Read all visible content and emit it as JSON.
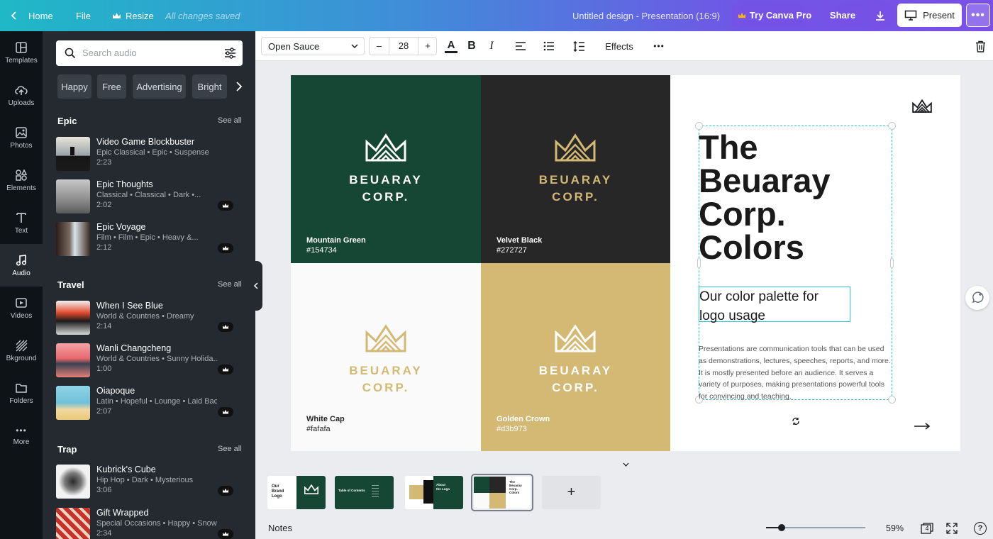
{
  "topbar": {
    "home": "Home",
    "file": "File",
    "resize": "Resize",
    "saved_status": "All changes saved",
    "doc_title": "Untitled design - Presentation (16:9)",
    "try_pro": "Try Canva Pro",
    "share": "Share",
    "present": "Present"
  },
  "rail": [
    {
      "label": "Templates",
      "icon": "templates-icon"
    },
    {
      "label": "Uploads",
      "icon": "upload-cloud-icon"
    },
    {
      "label": "Photos",
      "icon": "image-icon"
    },
    {
      "label": "Elements",
      "icon": "shapes-icon"
    },
    {
      "label": "Text",
      "icon": "text-t-icon"
    },
    {
      "label": "Audio",
      "icon": "music-note-icon"
    },
    {
      "label": "Videos",
      "icon": "video-play-icon"
    },
    {
      "label": "Bkground",
      "icon": "pattern-icon"
    },
    {
      "label": "Folders",
      "icon": "folder-icon"
    },
    {
      "label": "More",
      "icon": "more-dots-icon"
    }
  ],
  "audio_panel": {
    "search_placeholder": "Search audio",
    "chips": [
      "Happy",
      "Free",
      "Advertising",
      "Bright"
    ],
    "see_all": "See all",
    "sections": [
      {
        "title": "Epic",
        "tracks": [
          {
            "title": "Video Game Blockbuster",
            "meta": "Epic Classical • Epic • Suspense",
            "duration": "2:23",
            "pro": false
          },
          {
            "title": "Epic Thoughts",
            "meta": "Classical • Classical • Dark •...",
            "duration": "2:02",
            "pro": true
          },
          {
            "title": "Epic Voyage",
            "meta": "Film • Film • Epic • Heavy &...",
            "duration": "2:12",
            "pro": true
          }
        ]
      },
      {
        "title": "Travel",
        "tracks": [
          {
            "title": "When I See Blue",
            "meta": "World & Countries • Dreamy",
            "duration": "2:14",
            "pro": true
          },
          {
            "title": "Wanli Changcheng",
            "meta": "World & Countries • Sunny Holida...",
            "duration": "1:00",
            "pro": true
          },
          {
            "title": "Oiapoque",
            "meta": "Latin • Hopeful • Lounge • Laid Back",
            "duration": "2:07",
            "pro": true
          }
        ]
      },
      {
        "title": "Trap",
        "tracks": [
          {
            "title": "Kubrick's Cube",
            "meta": "Hip Hop • Dark • Mysterious",
            "duration": "3:06",
            "pro": true
          },
          {
            "title": "Gift Wrapped",
            "meta": "Special Occasions • Happy • Snow...",
            "duration": "2:34",
            "pro": true
          }
        ]
      }
    ]
  },
  "toolbar": {
    "font": "Open Sauce",
    "font_size": "28",
    "minus": "–",
    "plus": "+",
    "effects": "Effects"
  },
  "slide": {
    "swatches": [
      {
        "brand_line1": "BEUARAY",
        "brand_line2": "CORP.",
        "name": "Mountain Green",
        "hex": "#154734",
        "bg": "#154734",
        "fg": "#ffffff",
        "label": "#ffffff"
      },
      {
        "brand_line1": "BEUARAY",
        "brand_line2": "CORP.",
        "name": "Velvet Black",
        "hex": "#272727",
        "bg": "#272727",
        "fg": "#d3b973",
        "label": "#ffffff"
      },
      {
        "brand_line1": "BEUARAY",
        "brand_line2": "CORP.",
        "name": "White Cap",
        "hex": "#fafafa",
        "bg": "#fafafa",
        "fg": "#d3b973",
        "label": "#272727"
      },
      {
        "brand_line1": "BEUARAY",
        "brand_line2": "CORP.",
        "name": "Golden Crown",
        "hex": "#d3b973",
        "bg": "#d3b973",
        "fg": "#ffffff",
        "label": "#ffffff"
      }
    ],
    "heading_lines": [
      "The",
      "Beuaray",
      "Corp.",
      "Colors"
    ],
    "subheading_lines": [
      "Our color palette for",
      "logo usage"
    ],
    "body": "Presentations are communication tools that can be used as demonstrations, lectures, speeches, reports, and more. It is mostly presented before an audience. It serves a variety of purposes, making presentations powerful tools for convincing and teaching."
  },
  "pages": {
    "add_page": "+",
    "thumb1_text": [
      "Our",
      "Brand",
      "Logo"
    ],
    "thumb2_text": "Table of Contents",
    "thumb3_text": [
      "About",
      "the Logo"
    ],
    "thumb4_text": [
      "The",
      "Beuaray",
      "Corp.",
      "Colors"
    ]
  },
  "bottombar": {
    "notes": "Notes",
    "zoom": "59%",
    "page_count": "4",
    "zoom_level": 0.16
  },
  "colors": {
    "accent": "#00c4cc",
    "pro_crown": "#ffb800"
  }
}
